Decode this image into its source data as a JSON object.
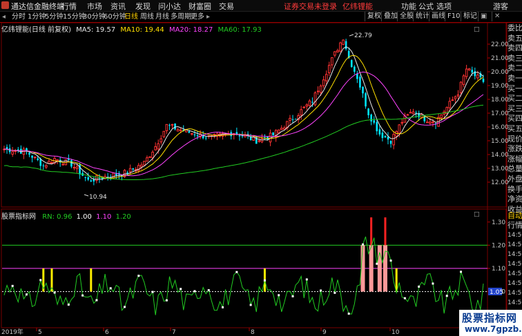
{
  "window": {
    "app_name": "通达信金融终端",
    "menus": [
      "行情",
      "市场",
      "资讯",
      "发现",
      "问小达",
      "财富圈",
      "交易"
    ],
    "notice": "证券交易未登录",
    "notice_stock": "亿纬锂能",
    "right_menus": [
      "功能",
      "公式",
      "选项"
    ],
    "user": "游客"
  },
  "toolbar": {
    "periods": [
      "分时",
      "1分钟",
      "5分钟",
      "15分钟",
      "30分钟",
      "60分钟",
      "日线",
      "周线",
      "月线",
      "多周期",
      "更多"
    ],
    "active_period": "日线",
    "right_buttons": [
      "复权",
      "叠加",
      "全股",
      "统计",
      "画线",
      "F10",
      "标记"
    ]
  },
  "main_chart": {
    "title": "亿纬锂能(日线 前复权)",
    "ma": [
      {
        "label": "MA5: 19.57",
        "color": "#e8e8e8"
      },
      {
        "label": "MA10: 19.44",
        "color": "#ffe000"
      },
      {
        "label": "MA20: 18.27",
        "color": "#ff44ff"
      },
      {
        "label": "MA60: 17.93",
        "color": "#22cc22"
      }
    ],
    "high_label": "22.79",
    "low_label": "10.94",
    "price_ticks": [
      "22.00",
      "21.00",
      "20.00",
      "19.00",
      "18.00",
      "17.00",
      "16.00",
      "15.00",
      "14.00",
      "13.00",
      "12.00"
    ]
  },
  "indicator": {
    "title": "股票指标网",
    "values": [
      {
        "label": "RN: 0.96",
        "color": "#22cc22"
      },
      {
        "label": "1.00",
        "color": "#ffffff"
      },
      {
        "label": "1.10",
        "color": "#ff44ff"
      },
      {
        "label": "1.20",
        "color": "#22cc22"
      }
    ],
    "ticks": [
      "1.30",
      "1.20",
      "1.10",
      "1.00",
      "0.90"
    ],
    "current_value": "1.05"
  },
  "x_axis": {
    "year_label": "2019年",
    "month_labels": [
      "5",
      "6",
      "7",
      "8",
      "9",
      "10"
    ]
  },
  "side_panel": {
    "top_labels": [
      "委比",
      "卖五",
      "卖四",
      "卖三",
      "卖二",
      "卖一",
      "买一",
      "买二",
      "买三",
      "买四",
      "买五",
      "现价",
      "涨跌",
      "涨幅",
      "总量",
      "外盘",
      "换手",
      "净资",
      "收益"
    ],
    "bottom_labels": [
      "自动",
      "行情",
      "14:50",
      "14:50",
      "14:50",
      "14:50",
      "14:50",
      "14:50",
      "14:50",
      "14:50",
      "14:50",
      "14:50"
    ]
  },
  "watermark": {
    "title": "股票指标网",
    "url": "www.7gpzb.com"
  },
  "colors": {
    "up": "#ff3333",
    "down": "#00e5ff",
    "indicator_line": "#22cc22",
    "signal_bar": "#ffee00",
    "signal_red": "#ff2222",
    "signal_pink": "#ff9999"
  }
}
